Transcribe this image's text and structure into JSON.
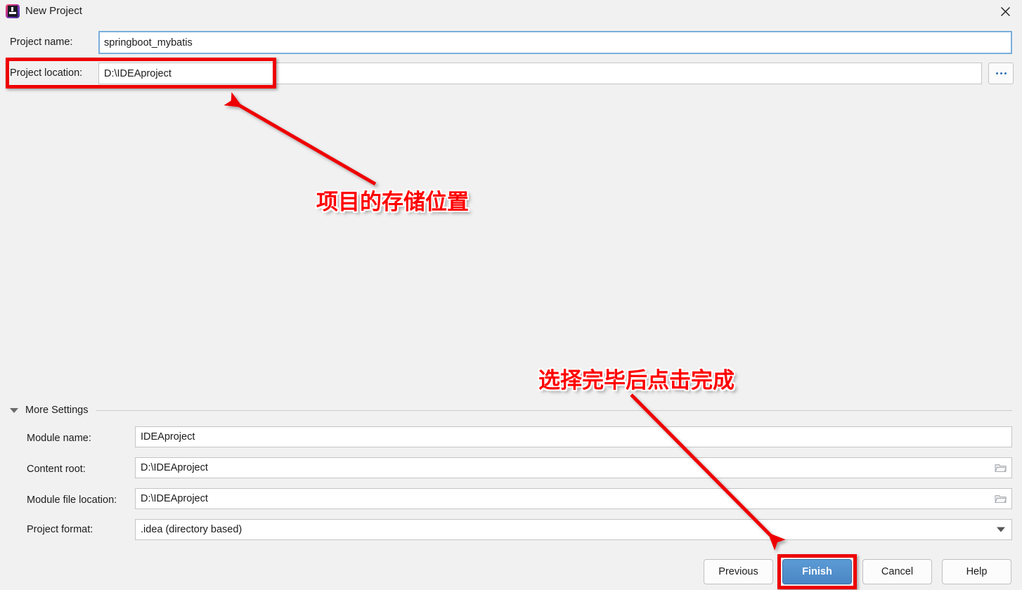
{
  "window": {
    "title": "New Project",
    "app_icon": "intellij-idea-icon",
    "close_label": "×",
    "background_color": "#f1f1f1"
  },
  "form": {
    "project_name": {
      "label": "Project name:",
      "value": "springboot_mybatis",
      "focused": true
    },
    "project_location": {
      "label": "Project location:",
      "value": "D:\\IDEAproject",
      "browse_button_label": "..."
    }
  },
  "more_settings": {
    "label": "More Settings",
    "expanded": true,
    "fields": [
      {
        "label": "Module name:",
        "value": "IDEAproject",
        "trailing_icon": "none"
      },
      {
        "label": "Content root:",
        "value": "D:\\IDEAproject",
        "trailing_icon": "folder-icon"
      },
      {
        "label": "Module file location:",
        "value": "D:\\IDEAproject",
        "trailing_icon": "folder-icon"
      },
      {
        "label": "Project format:",
        "value": ".idea (directory based)",
        "trailing_icon": "chevron-down-icon"
      }
    ]
  },
  "buttons": {
    "previous": "Previous",
    "finish": "Finish",
    "cancel": "Cancel",
    "help": "Help",
    "finish_color": "#4a86c4",
    "finish_text_color": "#ffffff"
  },
  "annotations": {
    "highlight_color": "#ee0000",
    "text_color": "#ff0000",
    "note_1": "项目的存储位置",
    "note_2": "选择完毕后点击完成"
  }
}
